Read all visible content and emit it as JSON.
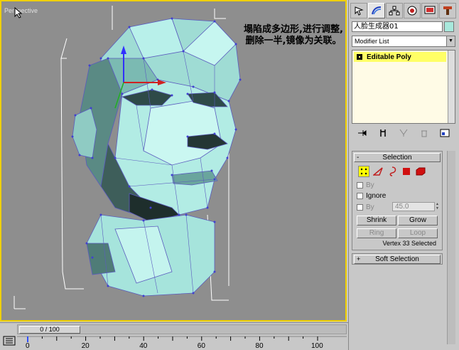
{
  "viewport": {
    "label": "Perspective",
    "annotation": "塌陷成多边形,进行调整,删除一半,镜像为关联。"
  },
  "command_panel": {
    "tabs": [
      "create-tab",
      "modify-tab",
      "hierarchy-tab",
      "motion-tab",
      "display-tab",
      "utilities-tab"
    ],
    "object_name": "人脸生成器01",
    "object_color": "#a8e8dc",
    "modifier_list": "Modifier List",
    "stack_item": "Editable Poly",
    "stack_item_dots": "•.",
    "selection": {
      "title": "Selection",
      "by_vertex_label": "By",
      "ignore_label": "Ignore",
      "by_angle_label": "By",
      "angle_value": "45.0",
      "shrink": "Shrink",
      "grow": "Grow",
      "ring": "Ring",
      "loop": "Loop",
      "status": "Vertex 33 Selected"
    },
    "soft_selection": {
      "title": "Soft Selection",
      "sign": "+"
    }
  },
  "timeline": {
    "position": "0 / 100",
    "ticks": [
      "0",
      "20",
      "40",
      "60",
      "80",
      "100"
    ]
  },
  "colors": {
    "viewport_border": "#f0d000",
    "mesh": "#a8e8dc",
    "active": "#ffff00"
  }
}
